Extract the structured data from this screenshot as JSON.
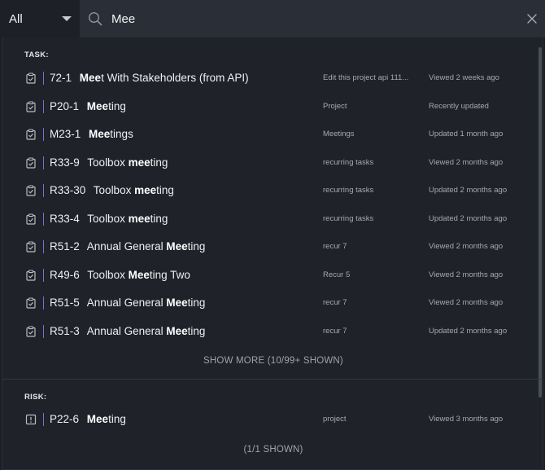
{
  "search": {
    "scope": "All",
    "query": "Mee"
  },
  "sections": [
    {
      "label": "TASK:",
      "footer": "SHOW MORE  (10/99+ SHOWN)",
      "items": [
        {
          "id": "72-1",
          "pre": "",
          "match": "Mee",
          "post": "t With Stakeholders (from API)",
          "project": "Edit this project api 111...",
          "status": "Viewed 2 weeks ago",
          "icon": "clipboard-icon"
        },
        {
          "id": "P20-1",
          "pre": "",
          "match": "Mee",
          "post": "ting",
          "project": "Project",
          "status": "Recently updated",
          "icon": "clipboard-icon"
        },
        {
          "id": "M23-1",
          "pre": "",
          "match": "Mee",
          "post": "tings",
          "project": "Meetings",
          "status": "Updated 1 month ago",
          "icon": "clipboard-icon"
        },
        {
          "id": "R33-9",
          "pre": "Toolbox ",
          "match": "mee",
          "post": "ting",
          "project": "recurring tasks",
          "status": "Viewed 2 months ago",
          "icon": "clipboard-icon"
        },
        {
          "id": "R33-30",
          "pre": "Toolbox ",
          "match": "mee",
          "post": "ting",
          "project": "recurring tasks",
          "status": "Updated 2 months ago",
          "icon": "clipboard-icon"
        },
        {
          "id": "R33-4",
          "pre": "Toolbox ",
          "match": "mee",
          "post": "ting",
          "project": "recurring tasks",
          "status": "Updated 2 months ago",
          "icon": "clipboard-icon"
        },
        {
          "id": "R51-2",
          "pre": "Annual General ",
          "match": "Mee",
          "post": "ting",
          "project": "recur 7",
          "status": "Viewed 2 months ago",
          "icon": "clipboard-icon"
        },
        {
          "id": "R49-6",
          "pre": "Toolbox ",
          "match": "Mee",
          "post": "ting Two",
          "project": "Recur 5",
          "status": "Viewed 2 months ago",
          "icon": "clipboard-icon"
        },
        {
          "id": "R51-5",
          "pre": "Annual General ",
          "match": "Mee",
          "post": "ting",
          "project": "recur 7",
          "status": "Viewed 2 months ago",
          "icon": "clipboard-icon"
        },
        {
          "id": "R51-3",
          "pre": "Annual General ",
          "match": "Mee",
          "post": "ting",
          "project": "recur 7",
          "status": "Updated 2 months ago",
          "icon": "clipboard-icon"
        }
      ]
    },
    {
      "label": "RISK:",
      "footer": "(1/1 SHOWN)",
      "items": [
        {
          "id": "P22-6",
          "pre": "",
          "match": "Mee",
          "post": "ting",
          "project": "project",
          "status": "Viewed 3 months ago",
          "icon": "risk-alert-icon"
        }
      ]
    }
  ]
}
